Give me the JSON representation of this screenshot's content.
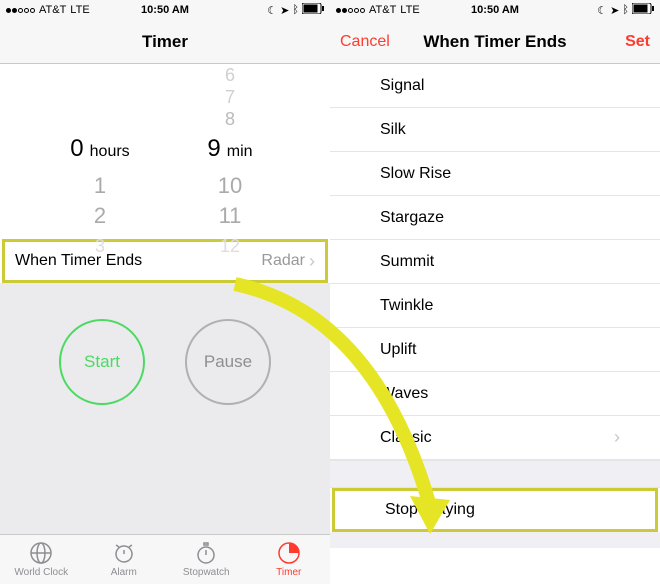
{
  "statusbar": {
    "carrier": "AT&T",
    "network": "LTE",
    "time": "10:50 AM"
  },
  "left": {
    "title": "Timer",
    "picker": {
      "hours_above": [
        "",
        ""
      ],
      "hours_selected": "0",
      "hours_unit": "hours",
      "hours_below": [
        "1",
        "2",
        "3"
      ],
      "min_above": [
        "6",
        "7",
        "8"
      ],
      "min_selected": "9",
      "min_unit": "min",
      "min_below": [
        "10",
        "11",
        "12"
      ]
    },
    "when_ends_label": "When Timer Ends",
    "when_ends_value": "Radar",
    "start_label": "Start",
    "pause_label": "Pause",
    "tabs": {
      "world_clock": "World Clock",
      "alarm": "Alarm",
      "stopwatch": "Stopwatch",
      "timer": "Timer"
    }
  },
  "right": {
    "cancel": "Cancel",
    "title": "When Timer Ends",
    "set": "Set",
    "sounds": [
      "Signal",
      "Silk",
      "Slow Rise",
      "Stargaze",
      "Summit",
      "Twinkle",
      "Uplift",
      "Waves",
      "Classic"
    ],
    "stop_playing": "Stop Playing"
  }
}
